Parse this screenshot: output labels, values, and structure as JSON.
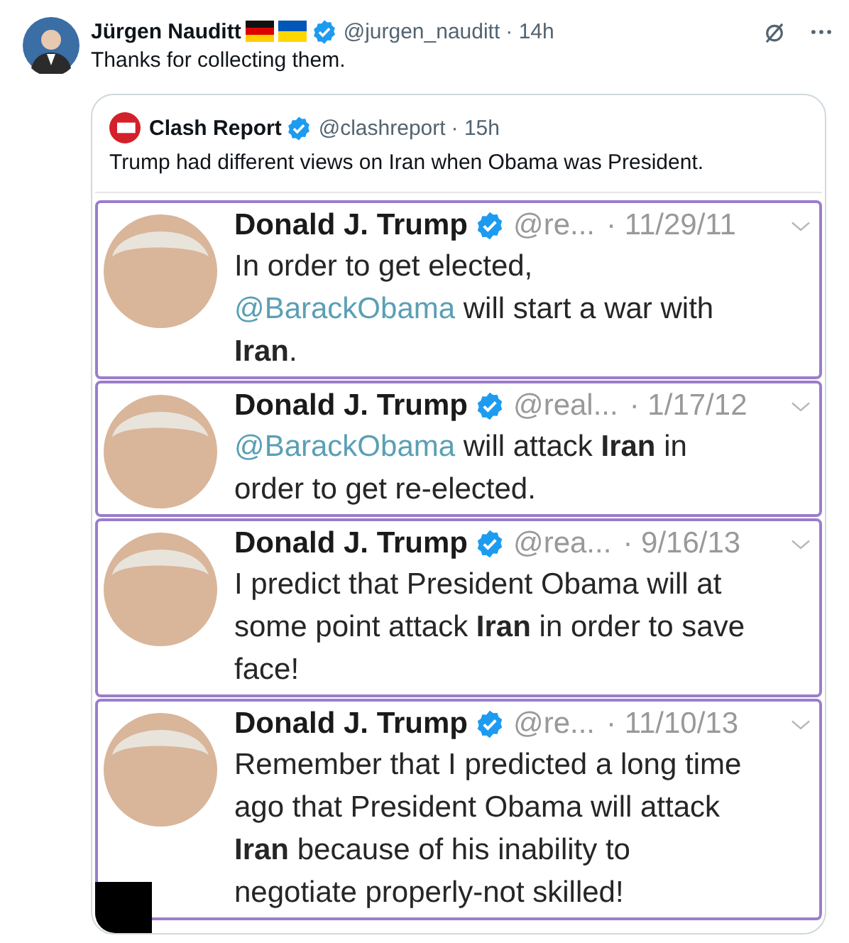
{
  "post": {
    "author": "Jürgen Nauditt",
    "verified": true,
    "handle": "@jurgen_nauditt",
    "time": "· 14h",
    "text": "Thanks for collecting them."
  },
  "quote": {
    "author": "Clash Report",
    "verified": true,
    "handle": "@clashreport",
    "time": "· 15h",
    "text": "Trump had different views on Iran when Obama was President.",
    "image": {
      "posts": [
        {
          "author": "Donald J. Trump",
          "handle": "@re...",
          "date": "· 11/29/11",
          "lines": [
            [
              {
                "kind": "text",
                "text": "In order to get elected,"
              }
            ],
            [
              {
                "kind": "mention",
                "text": "@BarackObama"
              },
              {
                "kind": "text",
                "text": " will start a war with"
              }
            ],
            [
              {
                "kind": "text",
                "text": "**Iran**."
              }
            ]
          ]
        },
        {
          "author": "Donald J. Trump",
          "handle": "@real...",
          "date": "· 1/17/12",
          "lines": [
            [
              {
                "kind": "mention",
                "text": "@BarackObama"
              },
              {
                "kind": "text",
                "text": " will attack **Iran** in"
              }
            ],
            [
              {
                "kind": "text",
                "text": "order to get re-elected."
              }
            ]
          ]
        },
        {
          "author": "Donald J. Trump",
          "handle": "@rea...",
          "date": "· 9/16/13",
          "lines": [
            [
              {
                "kind": "text",
                "text": "I predict that President Obama will at"
              }
            ],
            [
              {
                "kind": "text",
                "text": "some point attack **Iran** in order to save"
              }
            ],
            [
              {
                "kind": "text",
                "text": "face!"
              }
            ]
          ]
        },
        {
          "author": "Donald J. Trump",
          "handle": "@re...",
          "date": "· 11/10/13",
          "lines": [
            [
              {
                "kind": "text",
                "text": "Remember that I predicted a long time"
              }
            ],
            [
              {
                "kind": "text",
                "text": "ago that President Obama will attack"
              }
            ],
            [
              {
                "kind": "text",
                "text": "**Iran** because of his inability to"
              }
            ],
            [
              {
                "kind": "text",
                "text": "negotiate properly-not skilled!"
              }
            ]
          ]
        }
      ]
    }
  }
}
